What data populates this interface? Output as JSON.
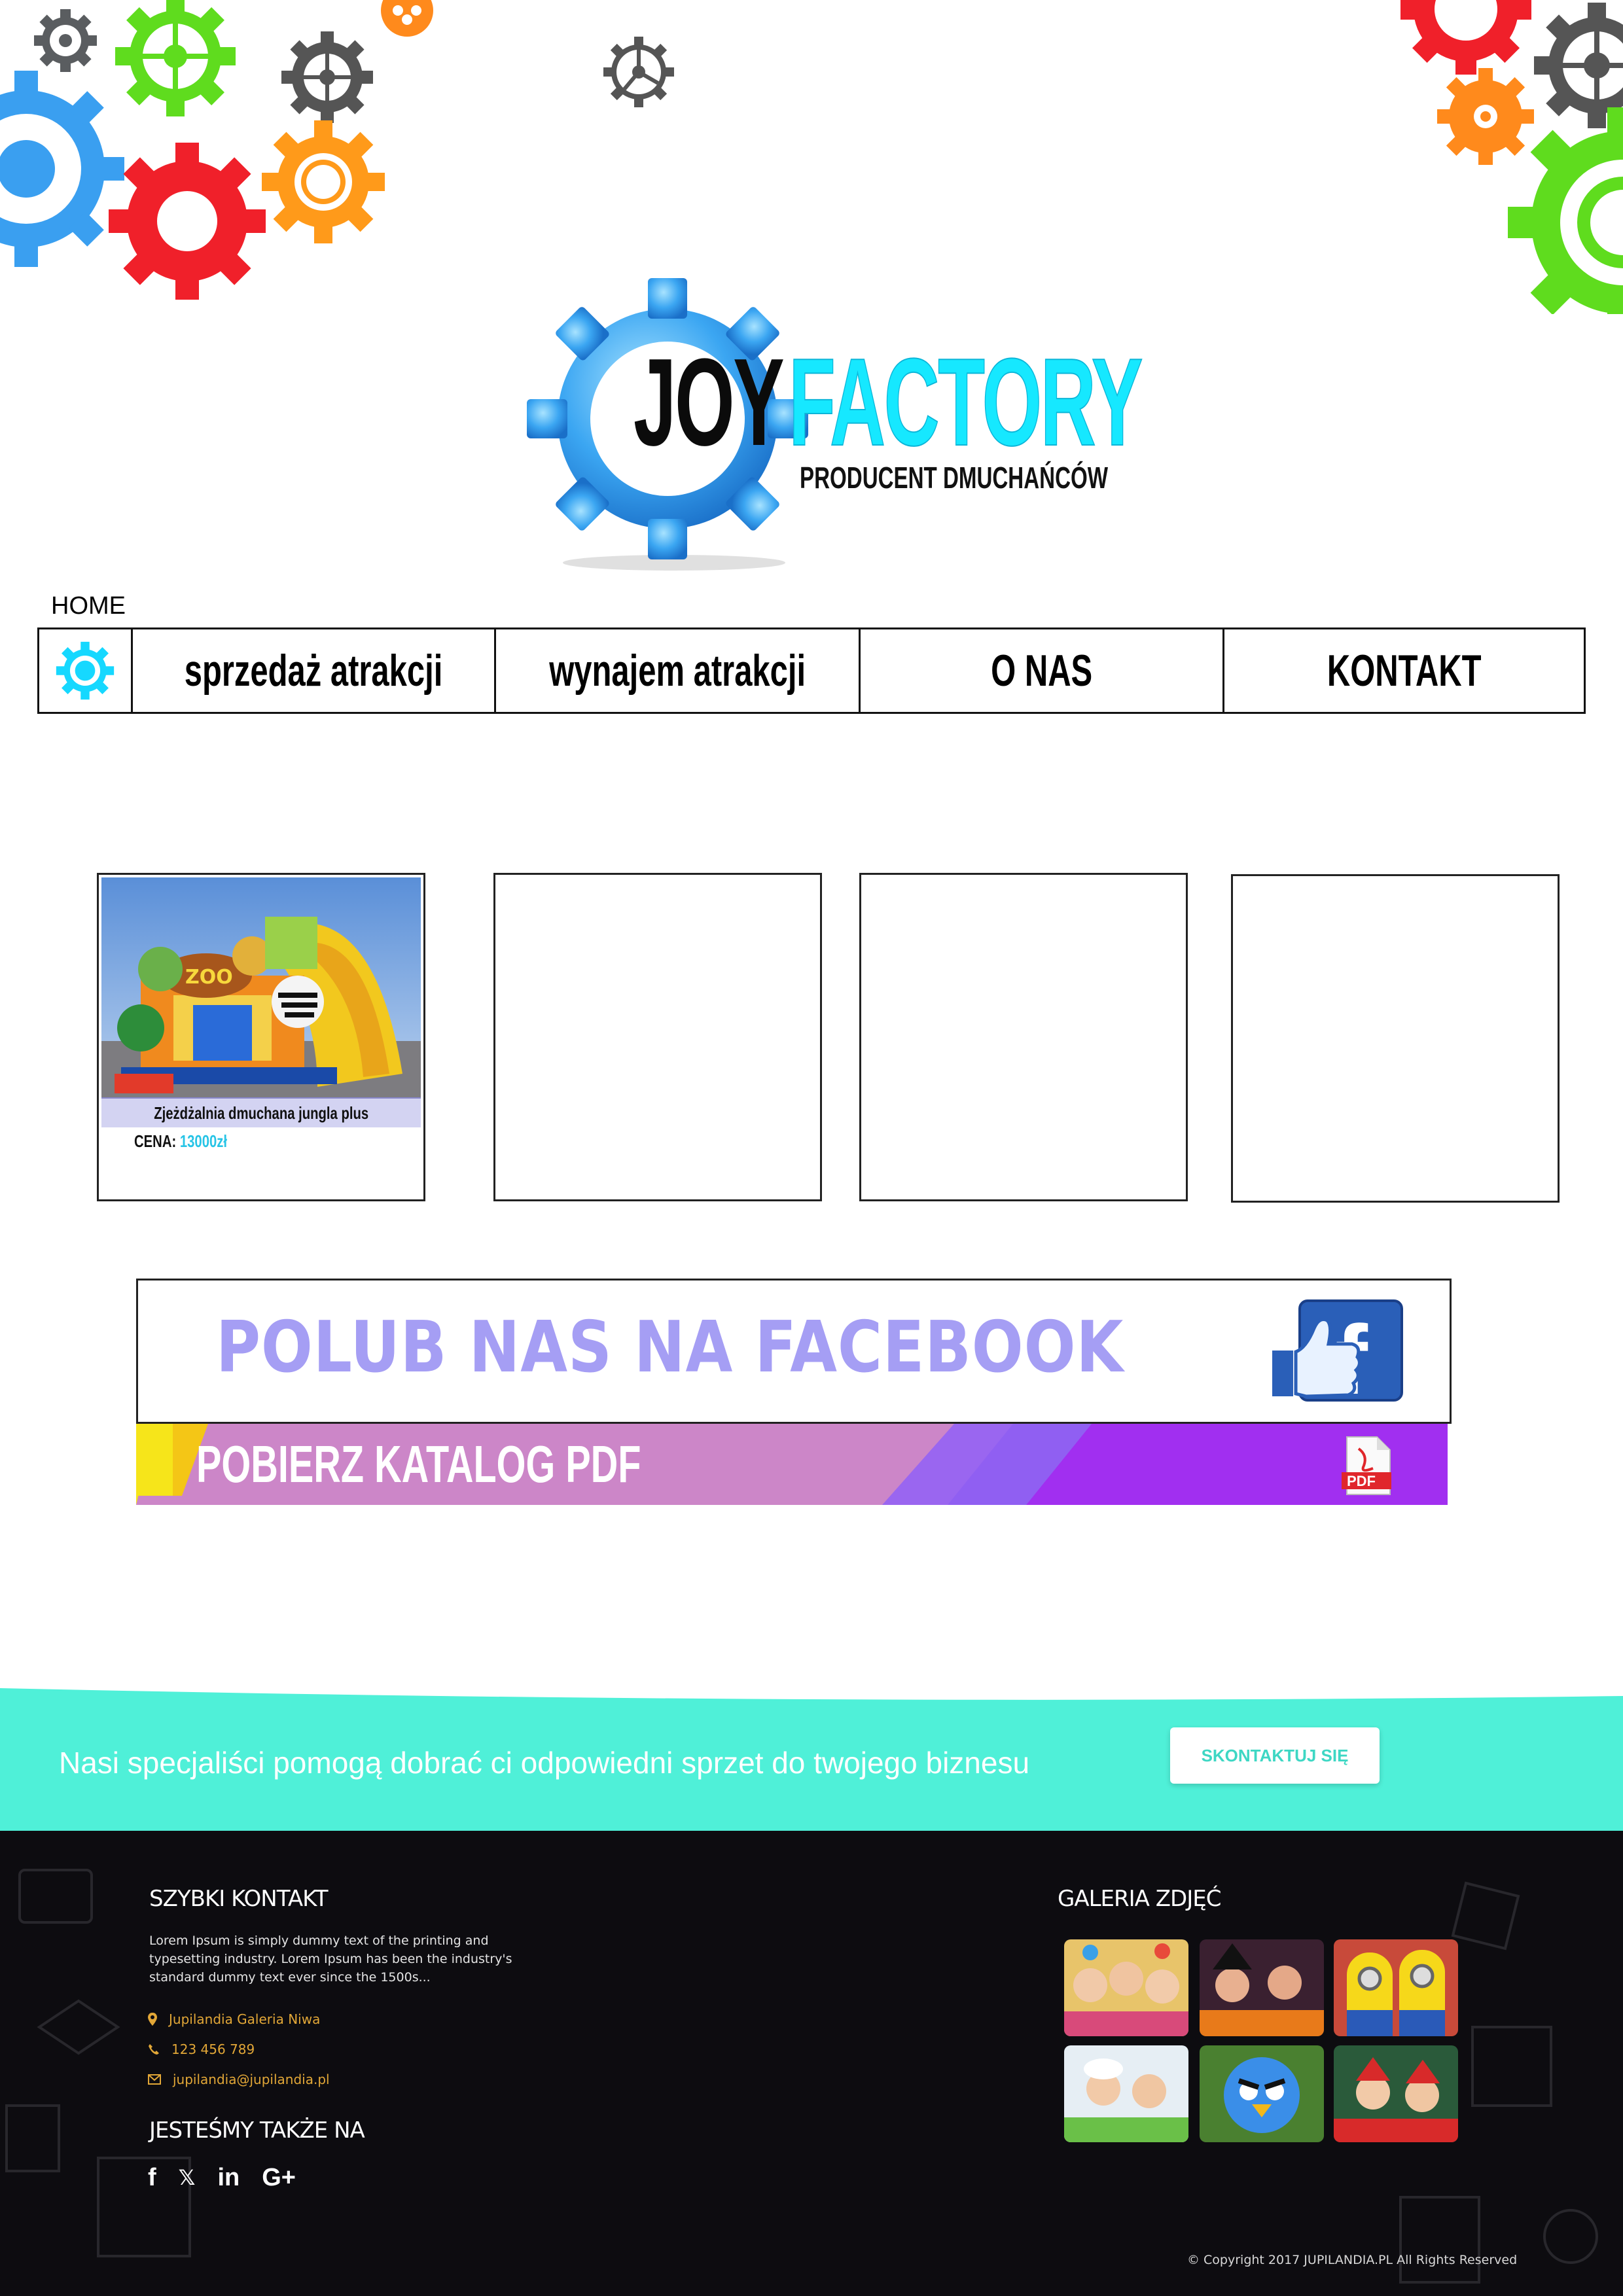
{
  "logo": {
    "word1": "JOY",
    "word2": "FACTORY",
    "tagline": "PRODUCENT DMUCHAŃCÓW"
  },
  "breadcrumb": {
    "home": "HOME"
  },
  "nav": {
    "items": [
      {
        "label": "sprzedaż atrakcji"
      },
      {
        "label": "wynajem atrakcji"
      },
      {
        "label": "O NAS"
      },
      {
        "label": "KONTAKT"
      }
    ]
  },
  "products": [
    {
      "name": "Zjeżdżalnia dmuchana jungla plus",
      "price_label": "CENA:",
      "price_value": "13000zł"
    }
  ],
  "facebook_banner": {
    "text": "POLUB NAS NA FACEBOOK"
  },
  "pdf_banner": {
    "text": "POBIERZ KATALOG PDF",
    "icon_label": "PDF"
  },
  "cta": {
    "text": "Nasi specjaliści pomogą dobrać ci odpowiedni sprzet do twojego biznesu",
    "button": "SKONTAKTUJ SIĘ"
  },
  "footer": {
    "quick_contact_title": "SZYBKI KONTAKT",
    "quick_contact_text": "Lorem Ipsum is simply dummy text of the printing and typesetting industry. Lorem Ipsum has been the industry's standard dummy text ever since the 1500s...",
    "address": "Jupilandia Galeria Niwa",
    "phone": "123 456 789",
    "email": "jupilandia@jupilandia.pl",
    "social_title": "JESTEŚMY TAKŻE NA",
    "social": [
      "f",
      "𝕏",
      "in",
      "G+"
    ],
    "gallery_title": "GALERIA ZDJĘĆ",
    "copyright": "© Copyright 2017 JUPILANDIA.PL All Rights Reserved"
  },
  "colors": {
    "accent_cyan": "#16e8ff",
    "teal_band": "#4ff0d8",
    "fb_text": "#a59ef4",
    "footer_bg": "#0d0c10",
    "footer_contact": "#e2a737"
  }
}
